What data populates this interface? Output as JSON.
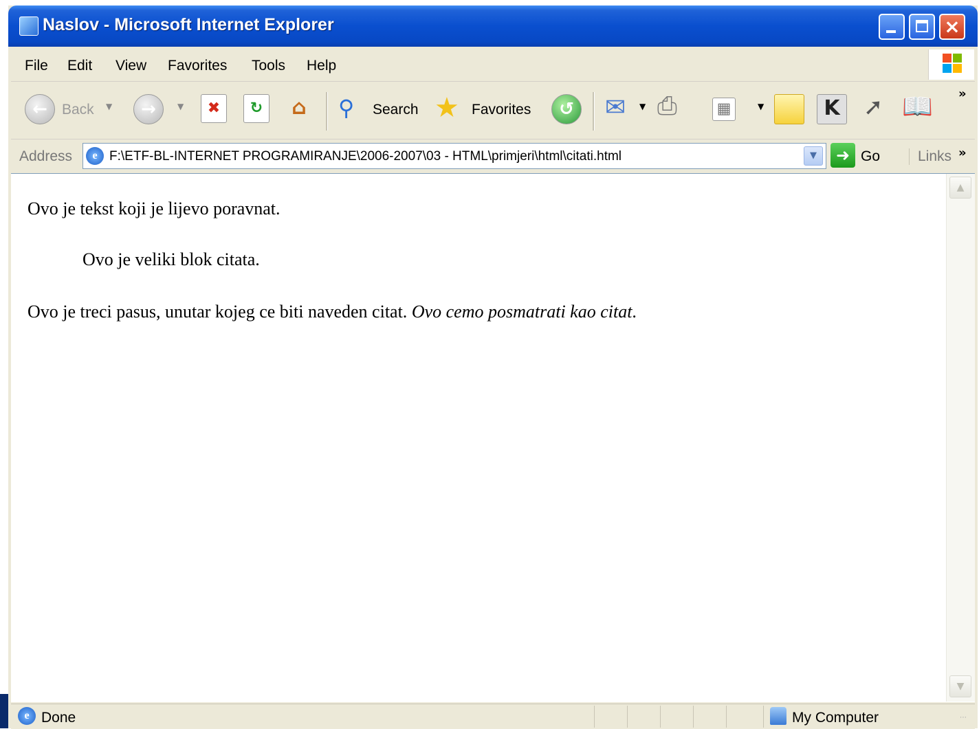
{
  "window": {
    "title": "Naslov - Microsoft Internet Explorer",
    "close_glyph": "×"
  },
  "menu": [
    "File",
    "Edit",
    "View",
    "Favorites",
    "Tools",
    "Help"
  ],
  "toolbar": {
    "back_label": "Back",
    "search_label": "Search",
    "favorites_label": "Favorites",
    "more_glyph": "»"
  },
  "address": {
    "label": "Address",
    "url": "F:\\ETF-BL-INTERNET PROGRAMIRANJE\\2006-2007\\03 - HTML\\primjeri\\html\\citati.html",
    "go_label": "Go",
    "links_label": "Links",
    "links_more": "»"
  },
  "page": {
    "paragraph1": "Ovo je tekst koji je lijevo poravnat.",
    "blockquote": "Ovo je veliki blok citata.",
    "paragraph3_text": "Ovo je treci pasus, unutar kojeg ce biti naveden citat.",
    "paragraph3_quote": "Ovo cemo posmatrati kao citat",
    "paragraph3_end": "."
  },
  "status": {
    "text": "Done",
    "zone": "My Computer"
  },
  "colors": {
    "titlebar": "#0a4fcf",
    "chrome": "#ece9d8",
    "content": "#ffffff"
  }
}
